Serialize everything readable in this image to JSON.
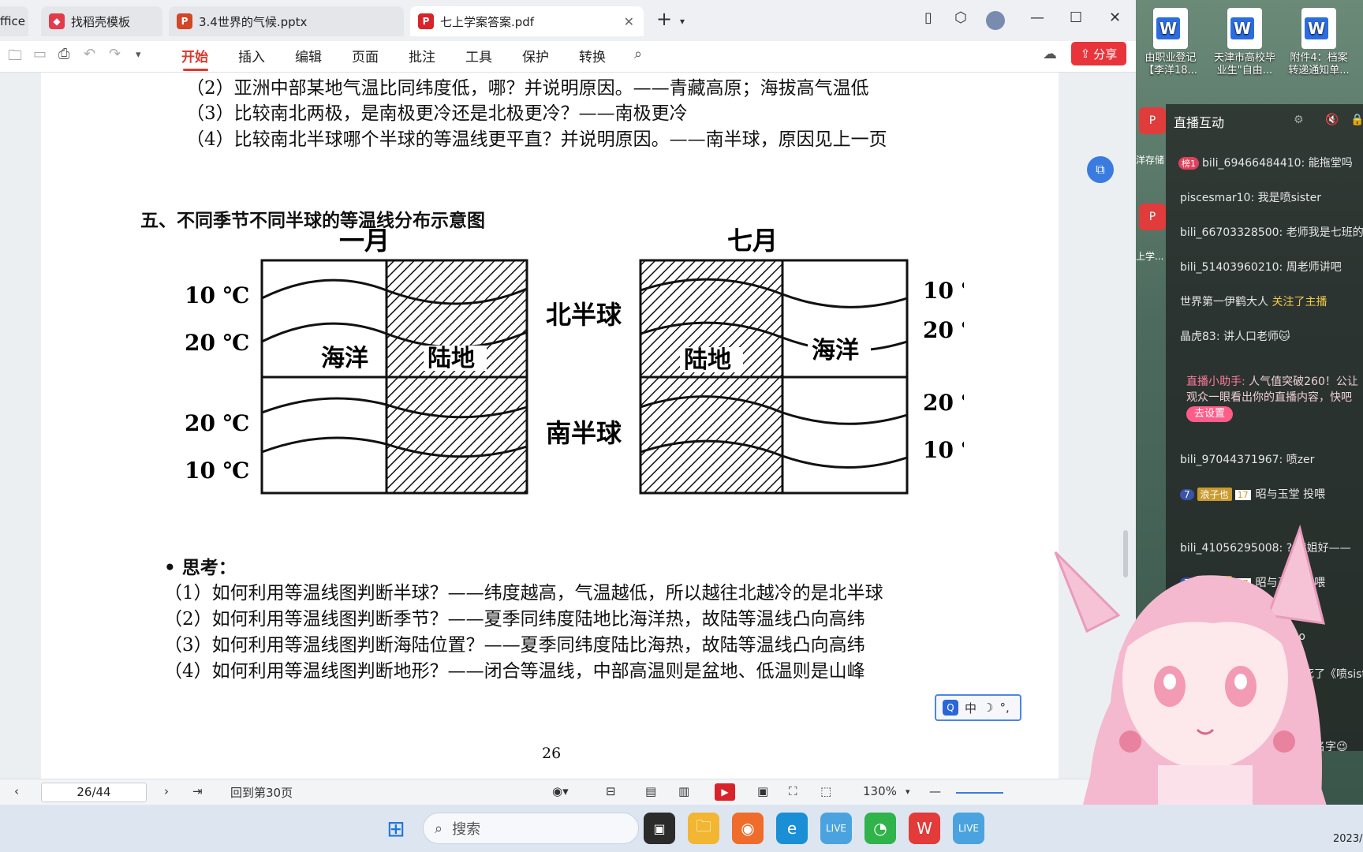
{
  "tabs": [
    {
      "label": "ffice"
    },
    {
      "label": "找稻壳模板",
      "icon": "docer-icon"
    },
    {
      "label": "3.4世界的气候.pptx",
      "icon": "ppt-icon"
    },
    {
      "label": "七上学案答案.pdf",
      "icon": "pdf-icon"
    }
  ],
  "menu": [
    "开始",
    "插入",
    "编辑",
    "页面",
    "批注",
    "工具",
    "保护",
    "转换"
  ],
  "share_label": "分享",
  "doc": {
    "top_lines": [
      "（2）亚洲中部某地气温比同纬度低，哪？并说明原因。——青藏高原；海拔高气温低",
      "（3）比较南北两极，是南极更冷还是北极更冷？——南极更冷",
      "（4）比较南北半球哪个半球的等温线更平直？并说明原因。——南半球，原因见上一页"
    ],
    "heading": "五、不同季节不同半球的等温线分布示意图",
    "diagram": {
      "jan_title": "一月",
      "jul_title": "七月",
      "ocean": "海洋",
      "land": "陆地",
      "north": "北半球",
      "south": "南半球",
      "t10": "10 ℃",
      "t20": "20 ℃"
    },
    "think_title": "• 思考：",
    "think_lines": [
      "（1）如何利用等温线图判断半球？——纬度越高，气温越低，所以越往北越冷的是北半球",
      "（2）如何利用等温线图判断季节？——夏季同纬度陆地比海洋热，故陆等温线凸向高纬",
      "（3）如何利用等温线图判断海陆位置？——夏季同纬度陆比海热，故陆等温线凸向高纬",
      "（4）如何利用等温线图判断地形？——闭合等温线，中部高温则是盆地、低温则是山峰"
    ],
    "page_number": "26"
  },
  "status": {
    "page_value": "26/44",
    "back_to": "回到第30页",
    "zoom": "130%"
  },
  "desktop_icons": [
    {
      "line1": "由职业登记",
      "line2": "【李洋18..."
    },
    {
      "line1": "天津市高校毕",
      "line2": "业生\"自由..."
    },
    {
      "line1": "附件4：档案",
      "line2": "转递通知单..."
    }
  ],
  "chat": {
    "title": "直播互动",
    "messages": [
      {
        "badge": "榜1",
        "text": "bili_69466484410: 能拖堂吗"
      },
      {
        "text": "piscesmar10: 我是喷sister"
      },
      {
        "text": "bili_66703328500: 老师我是七班的"
      },
      {
        "text": "bili_51403960210: 周老师讲吧"
      },
      {
        "text": "世界第一伊鹤大人 ",
        "follow": "关注了主播"
      },
      {
        "text": "晶虎83: 讲人口老师🐱"
      },
      {
        "text": "bili_97044371967: 喷zer"
      },
      {
        "text": "bili_41056295008: ? 喷姐好——"
      },
      {
        "text": "你是who"
      },
      {
        "text": "笑死了《喷siste"
      },
      {
        "text": "改个名字😉"
      }
    ],
    "helper_name": "直播小助手:",
    "helper_text": "人气值突破260！公让观众一眼看出你的直播内容，快吧",
    "helper_button": "去设置",
    "gift_level": "7",
    "gift_medal": "浪子也",
    "gift_medal_level": "17",
    "gift_text": "昭与玉堂 投喂"
  },
  "side_apps": [
    "洋存储",
    "上学..."
  ],
  "ime": {
    "mode": "中"
  },
  "taskbar": {
    "search_placeholder": "搜索",
    "clock": "2023/"
  }
}
